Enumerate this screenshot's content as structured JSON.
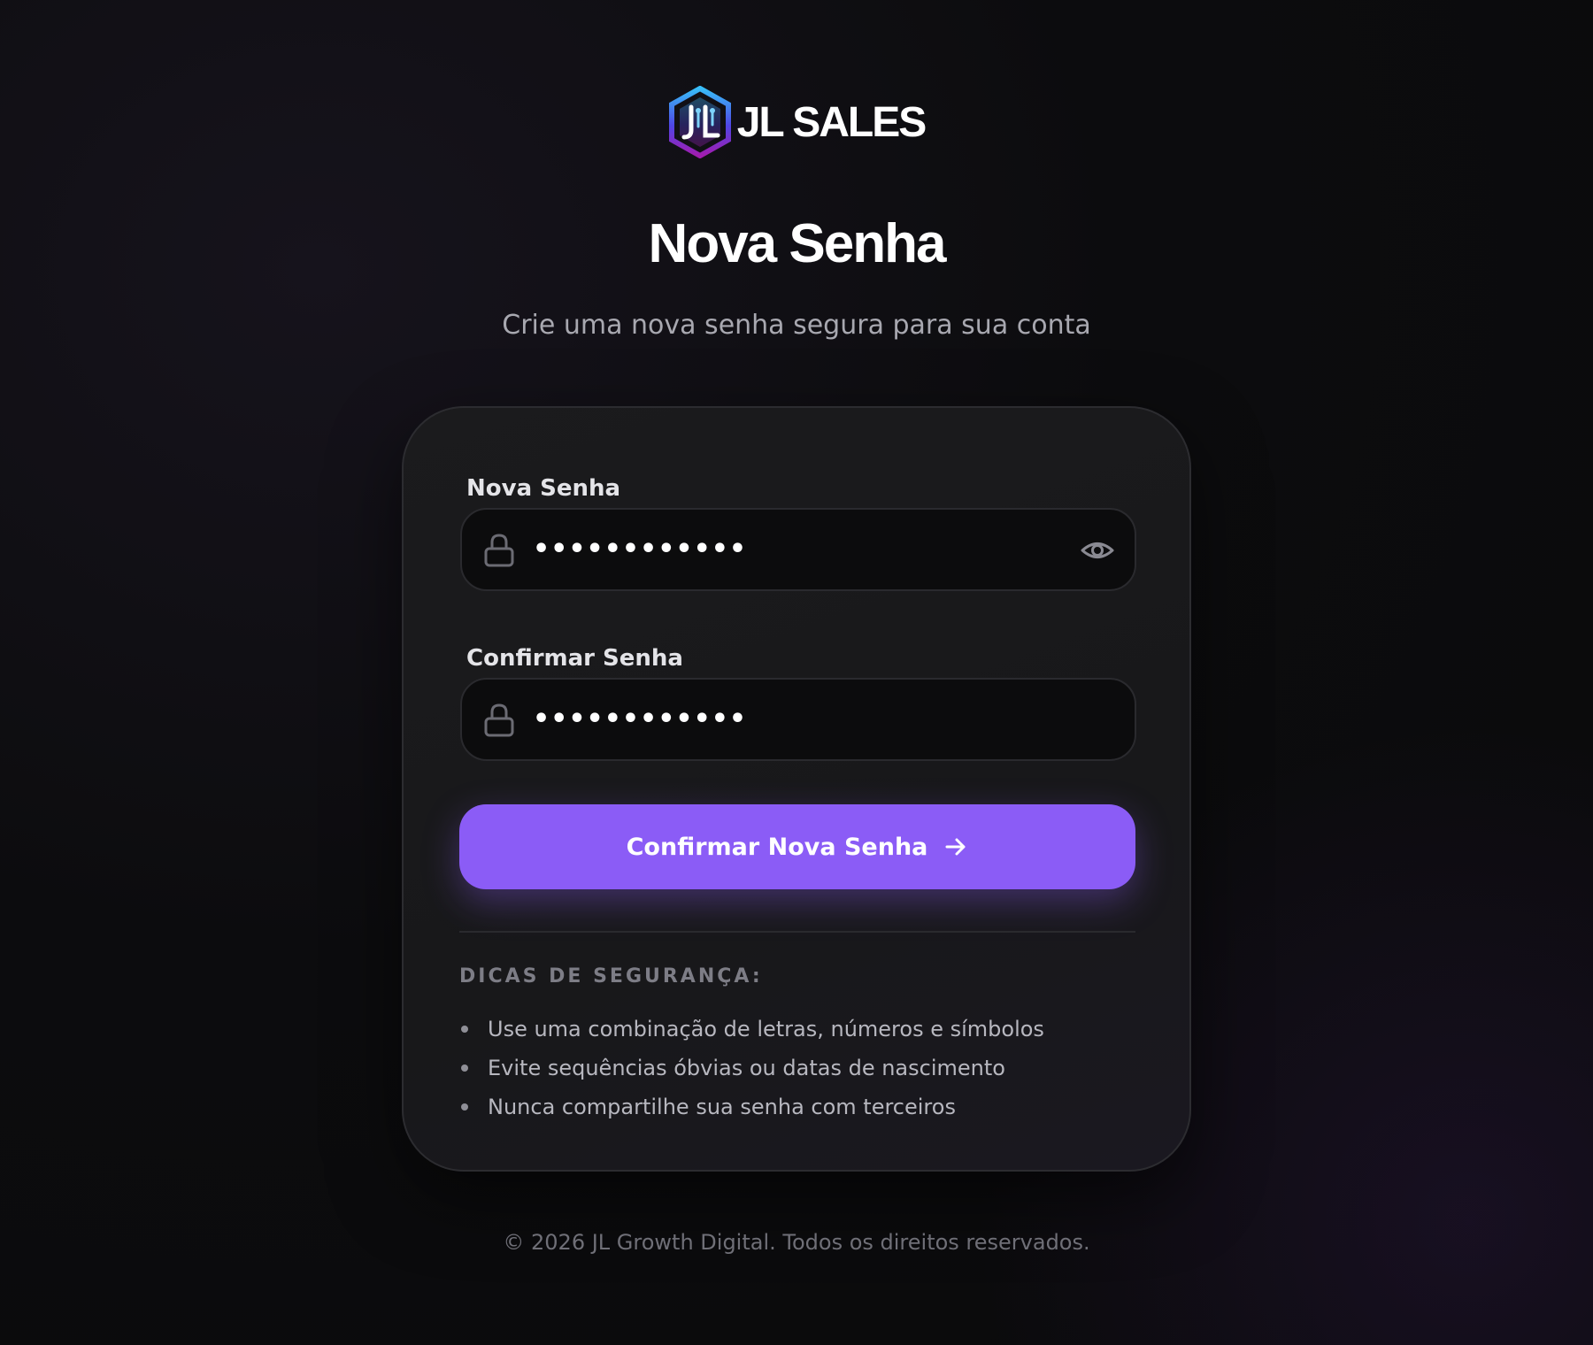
{
  "brand": {
    "name": "JL SALES",
    "accent_color": "#8b5cf6",
    "logo_icon": "hexagon-logo-icon"
  },
  "header": {
    "title": "Nova Senha",
    "subtitle": "Crie uma nova senha segura para sua conta"
  },
  "form": {
    "new_password": {
      "label": "Nova Senha",
      "value": "••••••••••••",
      "icon": "lock-icon",
      "toggle_icon": "eye-icon"
    },
    "confirm_password": {
      "label": "Confirmar Senha",
      "value": "••••••••••••",
      "icon": "lock-icon"
    },
    "submit_label": "Confirmar Nova Senha",
    "submit_icon": "arrow-right-icon"
  },
  "tips": {
    "heading": "DICAS DE SEGURANÇA:",
    "items": [
      "Use uma combinação de letras, números e símbolos",
      "Evite sequências óbvias ou datas de nascimento",
      "Nunca compartilhe sua senha com terceiros"
    ]
  },
  "footer": {
    "text": "© 2026 JL Growth Digital. Todos os direitos reservados."
  }
}
